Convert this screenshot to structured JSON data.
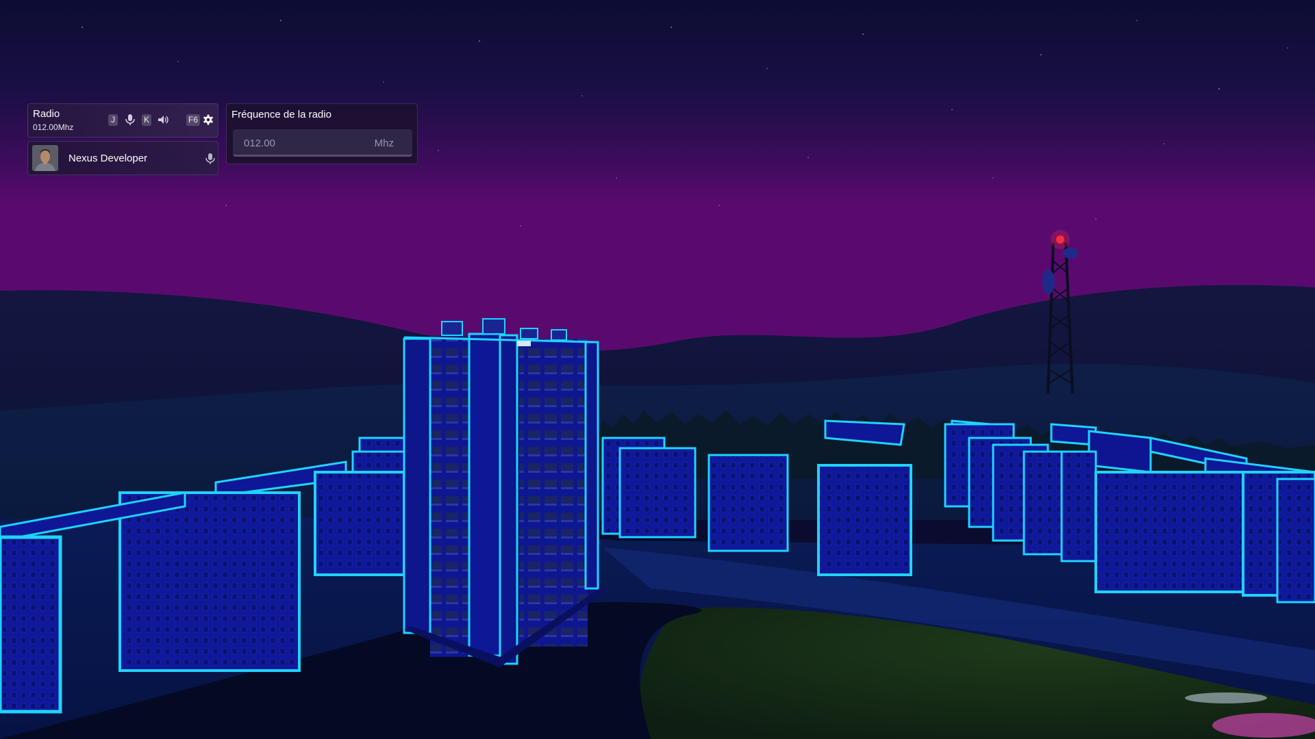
{
  "radio_panel": {
    "title": "Radio",
    "frequency_display": "012.00Mhz",
    "keys": {
      "key_j": "J",
      "key_k": "K",
      "key_f6": "F6"
    },
    "icons": [
      "microphone-icon",
      "speaker-icon",
      "gear-icon"
    ]
  },
  "player_row": {
    "name": "Nexus Developer",
    "icons": [
      "avatar",
      "microphone-icon"
    ]
  },
  "frequency_panel": {
    "title": "Fréquence de la radio",
    "value": "012.00",
    "unit": "Mhz"
  },
  "colors": {
    "neon_cyan": "#1ed4ff",
    "building_blue": "#10189a",
    "sky_purple": "#5a0a6e",
    "sky_top": "#0b0d33",
    "beacon_red": "#ff2a3a"
  }
}
